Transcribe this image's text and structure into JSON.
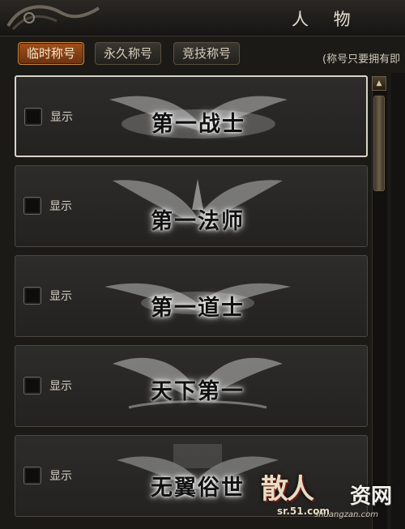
{
  "window": {
    "title": "人 物"
  },
  "tabs": [
    {
      "label": "临时称号",
      "active": true
    },
    {
      "label": "永久称号",
      "active": false
    },
    {
      "label": "竞技称号",
      "active": false
    }
  ],
  "hint_text": "(称号只要拥有即",
  "rows": [
    {
      "show_label": "显示",
      "title": "第一战士",
      "checked": false,
      "selected": true
    },
    {
      "show_label": "显示",
      "title": "第一法师",
      "checked": false,
      "selected": false
    },
    {
      "show_label": "显示",
      "title": "第一道士",
      "checked": false,
      "selected": false
    },
    {
      "show_label": "显示",
      "title": "天下第一",
      "checked": false,
      "selected": false
    },
    {
      "show_label": "显示",
      "title": "无翼俗世",
      "checked": false,
      "selected": false
    }
  ],
  "watermark": {
    "logo": "散人",
    "site": "资网",
    "url": "sr.51.com",
    "url2": "shuangzan.com"
  },
  "colors": {
    "accent_tab": "#a0511c",
    "panel_bg": "#2d2c2a",
    "border": "#4a4740"
  }
}
